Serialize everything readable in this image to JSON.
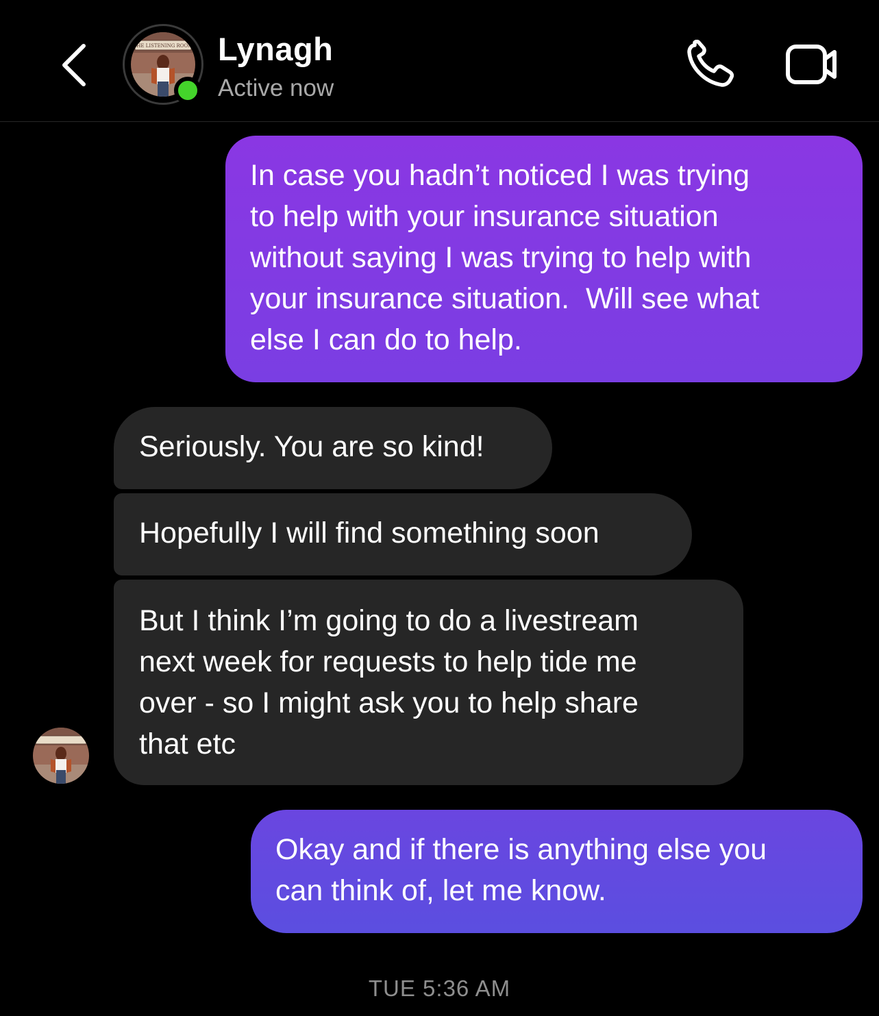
{
  "header": {
    "back_icon": "chevron-left-icon",
    "contact_name": "Lynagh",
    "status": "Active now",
    "avatar_sign_text": "THE LISTENING ROOM",
    "call_icon": "phone-icon",
    "video_icon": "video-camera-icon",
    "online_color": "#44d42b"
  },
  "messages": [
    {
      "direction": "sent",
      "lines": [
        "In case you hadn’t noticed I was trying",
        "to help with your insurance situation",
        "without saying I was trying to help with",
        "your insurance situation.  Will see what",
        "else I can do to help."
      ]
    },
    {
      "direction": "received",
      "lines": [
        "Seriously. You are so kind!"
      ]
    },
    {
      "direction": "received",
      "lines": [
        "Hopefully I will find something soon"
      ]
    },
    {
      "direction": "received",
      "lines": [
        "But I think I’m going to do a livestream",
        "next week for requests to help tide me",
        "over - so I might ask you to help share",
        "that etc"
      ]
    },
    {
      "direction": "sent",
      "lines": [
        "Okay and if there is anything else you",
        "can think of, let me know."
      ]
    }
  ],
  "timestamp": "TUE 5:36 AM",
  "colors": {
    "background": "#000000",
    "sent_bubble_top": "#8a37e3",
    "sent_bubble_bottom": "#5b4ee0",
    "received_bubble": "#262626",
    "secondary_text": "#a8a8a8"
  }
}
